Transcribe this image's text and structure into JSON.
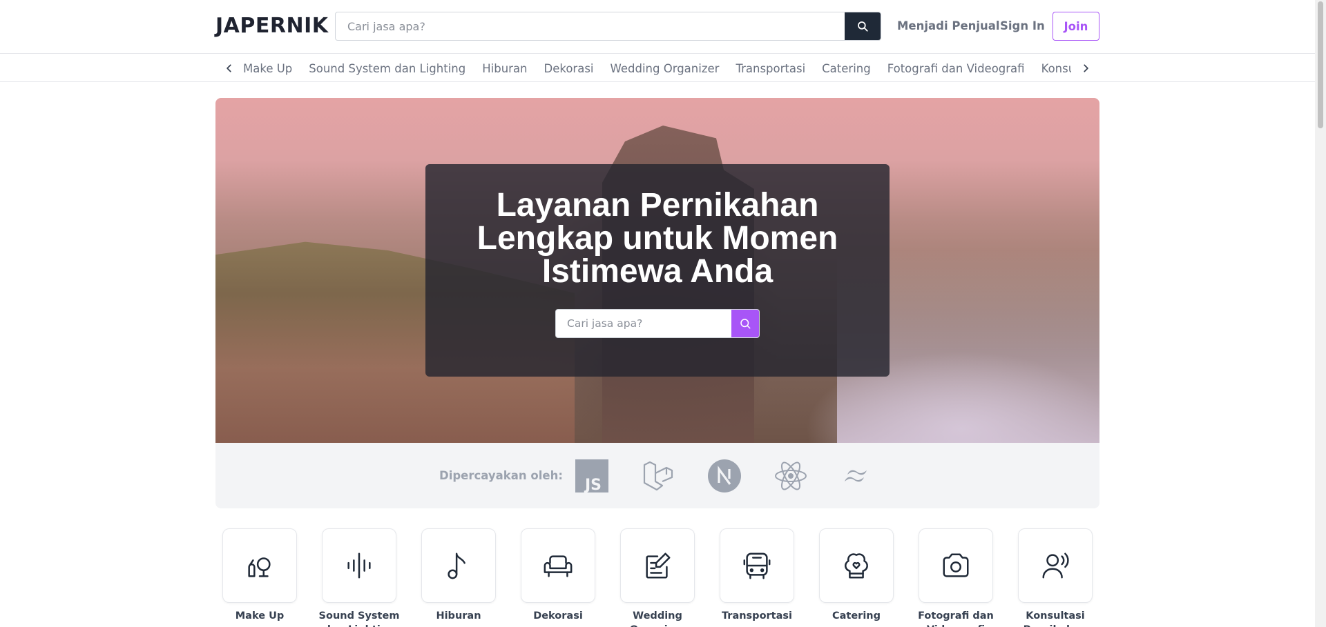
{
  "header": {
    "logo": "JAPERNIK",
    "search_placeholder": "Cari jasa apa?",
    "menjadi_penjual": "Menjadi Penjual",
    "sign_in": "Sign In",
    "join": "Join"
  },
  "categories": [
    "Make Up",
    "Sound System dan Lighting",
    "Hiburan",
    "Dekorasi",
    "Wedding Organizer",
    "Transportasi",
    "Catering",
    "Fotografi dan Videografi",
    "Konsultasi Pernikahan"
  ],
  "hero": {
    "title_line1": "Layanan Pernikahan",
    "title_line2": "Lengkap untuk Momen",
    "title_line3": "Istimewa Anda",
    "search_placeholder": "Cari jasa apa?"
  },
  "trusted": {
    "label": "Dipercayakan oleh:",
    "logos": [
      "javascript-logo",
      "laravel-logo",
      "nextjs-logo",
      "react-logo",
      "tailwind-logo"
    ]
  },
  "tiles": [
    {
      "label": "Make Up",
      "icon": "makeup-icon"
    },
    {
      "label": "Sound System dan Lighting",
      "icon": "sound-wave-icon"
    },
    {
      "label": "Hiburan",
      "icon": "music-note-icon"
    },
    {
      "label": "Dekorasi",
      "icon": "sofa-icon"
    },
    {
      "label": "Wedding Organizer",
      "icon": "edit-note-icon"
    },
    {
      "label": "Transportasi",
      "icon": "bus-icon"
    },
    {
      "label": "Catering",
      "icon": "chef-hat-icon"
    },
    {
      "label": "Fotografi dan Videografi",
      "icon": "camera-icon"
    },
    {
      "label": "Konsultasi Pernikahan",
      "icon": "user-voice-icon"
    }
  ],
  "colors": {
    "accent": "#a855f7",
    "dark": "#1f2937",
    "muted_text": "#6b7280"
  }
}
